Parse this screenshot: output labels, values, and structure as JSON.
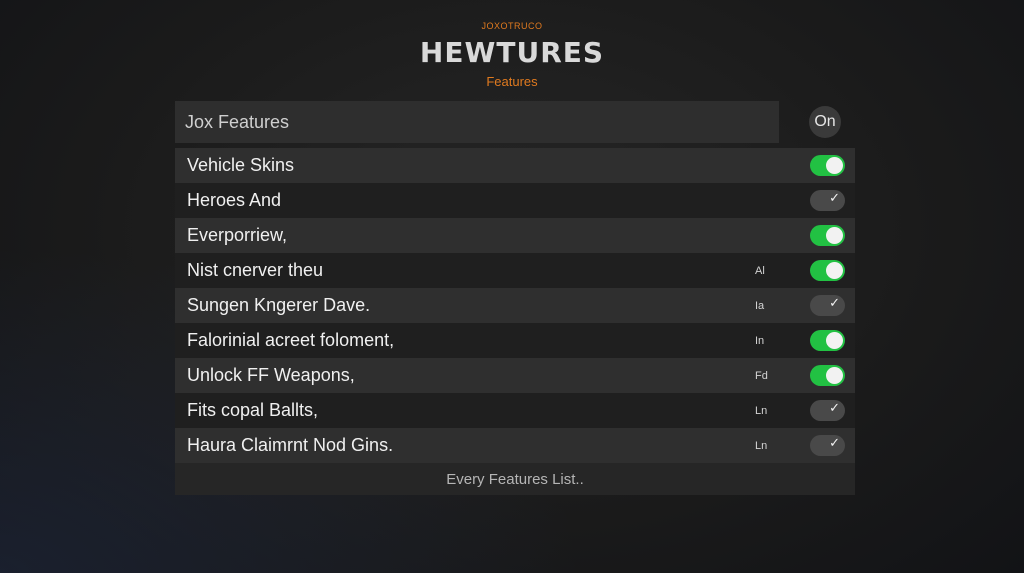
{
  "header": {
    "kicker": "JOXOTRUCO",
    "title": "HEWTURES",
    "subtitle": "Features"
  },
  "panel": {
    "title": "Jox Features",
    "status": "On"
  },
  "features": [
    {
      "label": "Vehicle Skins",
      "tag": "",
      "toggle": "on"
    },
    {
      "label": "Heroes And",
      "tag": "",
      "toggle": "check"
    },
    {
      "label": "Everporriew,",
      "tag": "",
      "toggle": "on"
    },
    {
      "label": "Nist cnerver theu",
      "tag": "Al",
      "toggle": "on"
    },
    {
      "label": "Sungen Kngerer Dave.",
      "tag": "Ia",
      "toggle": "check"
    },
    {
      "label": "Falorinial acreet foloment,",
      "tag": "In",
      "toggle": "on"
    },
    {
      "label": "Unlock FF Weapons,",
      "tag": "Fd",
      "toggle": "on"
    },
    {
      "label": "Fits copal Ballts,",
      "tag": "Ln",
      "toggle": "check"
    },
    {
      "label": "Haura Claimrnt Nod Gins.",
      "tag": "Ln",
      "toggle": "check"
    }
  ],
  "footer": {
    "label": "Every Features List.."
  },
  "colors": {
    "accent": "#e07a1f",
    "toggle_on": "#22c143",
    "toggle_off": "#494949"
  },
  "icons": {
    "check": "check-icon"
  }
}
